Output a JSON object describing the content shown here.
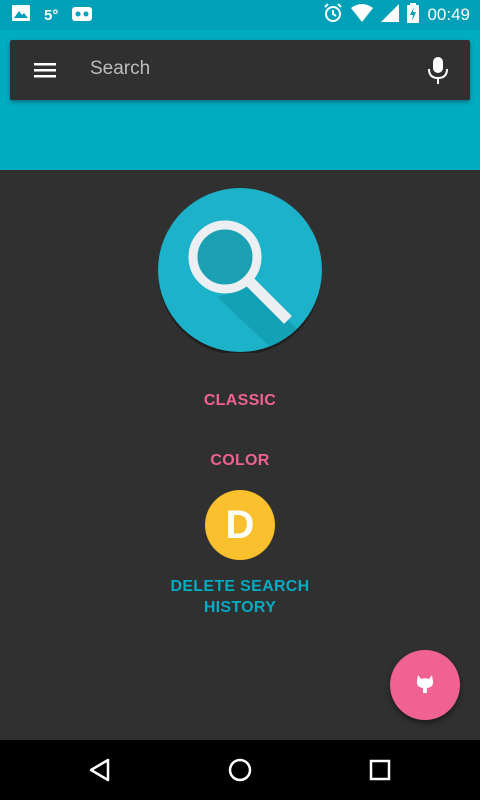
{
  "status_bar": {
    "temperature": "5°",
    "time": "00:49",
    "icons": [
      "image-icon",
      "android-debug-icon",
      "alarm-icon",
      "wifi-icon",
      "signal-icon",
      "battery-charging-icon"
    ]
  },
  "search": {
    "placeholder": "Search",
    "icons": [
      "menu-icon",
      "mic-icon"
    ]
  },
  "main": {
    "logo_icon": "search-logo-icon",
    "classic_label": "CLASSIC",
    "color_label": "COLOR",
    "avatar_letter": "D",
    "delete_label_line1": "DELETE SEARCH",
    "delete_label_line2": "HISTORY"
  },
  "fab": {
    "icon": "github-icon"
  },
  "nav_bar": {
    "icons": [
      "back-icon",
      "home-icon",
      "recents-icon"
    ]
  },
  "colors": {
    "accent": "#00acc1",
    "status_bar": "#00a0b8",
    "pink": "#f06292",
    "avatar": "#fbc02d",
    "background": "#303030"
  }
}
